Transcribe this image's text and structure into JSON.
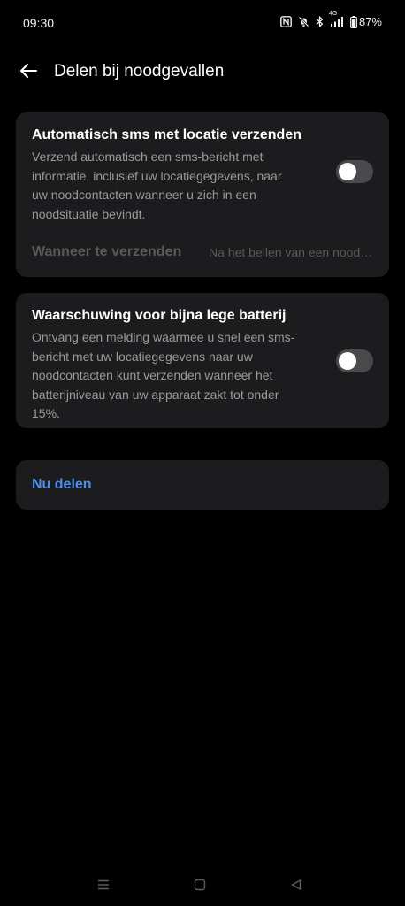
{
  "status_bar": {
    "time": "09:30",
    "network": "4G",
    "battery": "87%",
    "icons": [
      "nfc-icon",
      "mute-icon",
      "bluetooth-icon",
      "signal-icon",
      "battery-icon"
    ]
  },
  "header": {
    "title": "Delen bij noodgevallen",
    "back_icon": "arrow-left-icon"
  },
  "settings": [
    {
      "title": "Automatisch sms met locatie verzenden",
      "description": "Verzend automatisch een sms-bericht met informatie, inclusief uw locatiegegevens, naar uw noodcontacten wanneer u zich in een noodsituatie bevindt.",
      "enabled": false
    },
    {
      "title": "Waarschuwing voor bijna lege batterij",
      "description": "Ontvang een melding waarmee u snel een sms-bericht met uw locatiegegevens naar uw noodcontacten kunt verzenden wanneer het batterijniveau van uw apparaat zakt tot onder 15%.",
      "enabled": false
    }
  ],
  "when_to_send": {
    "label": "Wanneer te verzenden",
    "value": "Na het bellen van een noodnummer"
  },
  "share_now": {
    "label": "Nu delen"
  },
  "colors": {
    "background": "#000000",
    "card": "#1c1c1e",
    "accent": "#4d8fe8",
    "secondary_text": "#9a9a9a",
    "disabled_text": "#5a5a5a",
    "toggle_off": "#4a4a4c"
  },
  "nav_bar": {
    "icons": [
      "menu-icon",
      "home-icon",
      "back-triangle-icon"
    ]
  }
}
